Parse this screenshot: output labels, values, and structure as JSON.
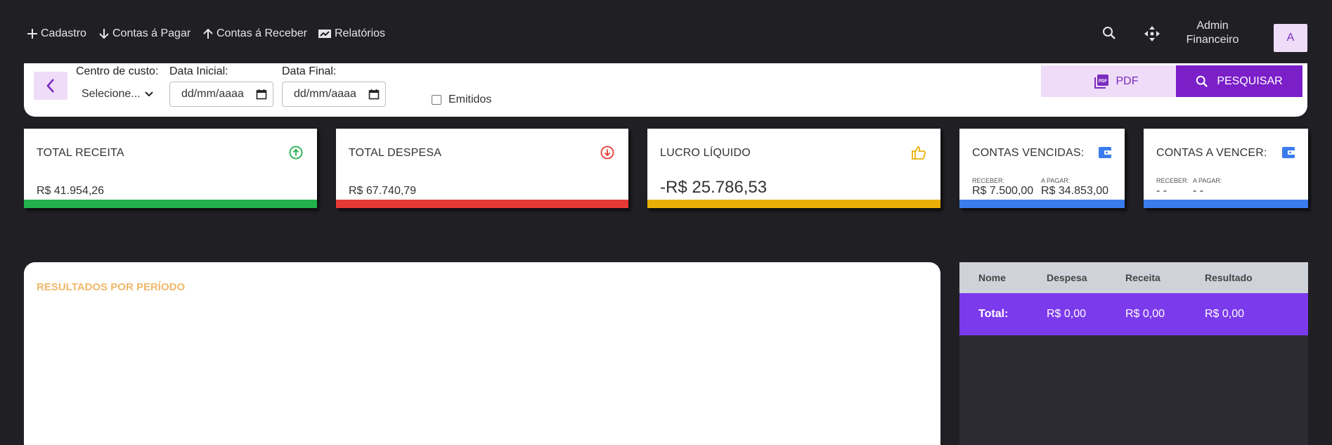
{
  "nav": {
    "items": [
      {
        "label": "Cadastro",
        "icon": "plus-icon"
      },
      {
        "label": "Contas á Pagar",
        "icon": "arrow-down-icon"
      },
      {
        "label": "Contas á Receber",
        "icon": "arrow-up-icon"
      },
      {
        "label": "Relatórios",
        "icon": "report-icon"
      }
    ],
    "user": {
      "name_line1": "Admin",
      "name_line2": "Financeiro",
      "avatar_letter": "A"
    }
  },
  "filters": {
    "centro_label": "Centro de custo:",
    "centro_value": "Selecione...",
    "data_inicial_label": "Data Inicial:",
    "data_inicial_value": "dd/mm/aaaa",
    "data_final_label": "Data Final:",
    "data_final_value": "dd/mm/aaaa",
    "emitidos_label": "Emitidos",
    "pdf_label": "PDF",
    "search_label": "PESQUISAR"
  },
  "cards": {
    "receita": {
      "title": "TOTAL RECEITA",
      "value": "R$ 41.954,26",
      "color": "#22b14c"
    },
    "despesa": {
      "title": "TOTAL DESPESA",
      "value": "R$ 67.740,79",
      "color": "#e53935"
    },
    "lucro": {
      "title": "LUCRO LÍQUIDO",
      "value": "-R$ 25.786,53",
      "color": "#e8b008"
    },
    "vencidas": {
      "title": "CONTAS VENCIDAS:",
      "receber_label": "RECEBER:",
      "receber_value": "R$ 7.500,00",
      "pagar_label": "A PAGAR:",
      "pagar_value": "R$ 34.853,00",
      "color": "#3b7ced"
    },
    "a_vencer": {
      "title": "CONTAS A VENCER:",
      "receber_label": "RECEBER:",
      "receber_value": "- -",
      "pagar_label": "A PAGAR:",
      "pagar_value": "- -",
      "color": "#3b7ced"
    }
  },
  "chart_panel": {
    "title": "RESULTADOS POR PERÍODO"
  },
  "results_table": {
    "headers": [
      "Nome",
      "Despesa",
      "Receita",
      "Resultado"
    ],
    "total": {
      "label": "Total:",
      "despesa": "R$ 0,00",
      "receita": "R$ 0,00",
      "resultado": "R$ 0,00"
    }
  }
}
